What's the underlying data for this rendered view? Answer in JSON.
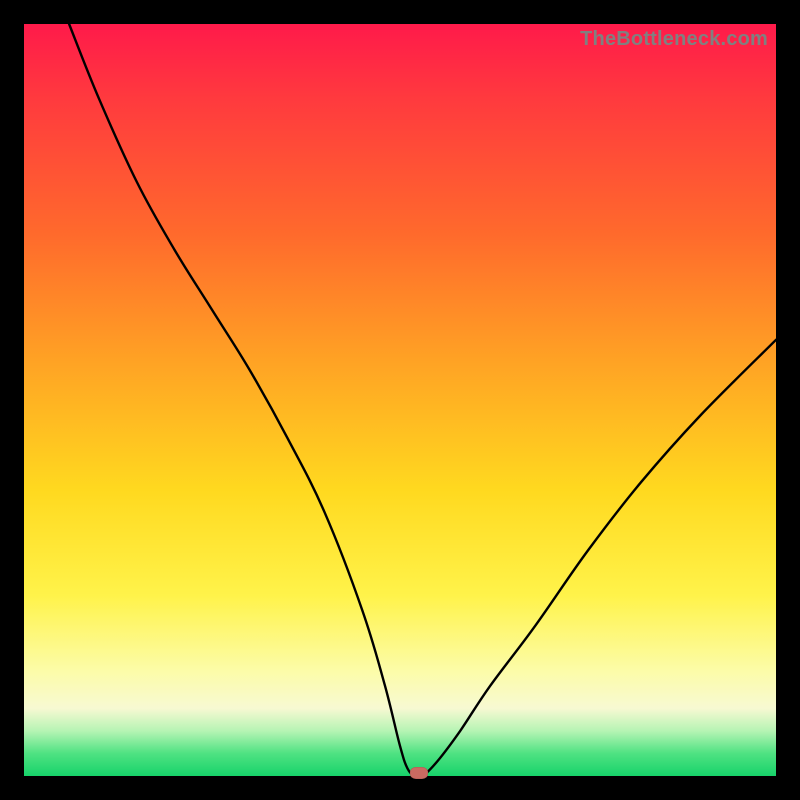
{
  "watermark": "TheBottleneck.com",
  "chart_data": {
    "type": "line",
    "title": "",
    "xlabel": "",
    "ylabel": "",
    "xlim": [
      0,
      100
    ],
    "ylim": [
      0,
      100
    ],
    "grid": false,
    "legend": false,
    "marker": {
      "x": 52.5,
      "y": 0
    },
    "series": [
      {
        "name": "curve",
        "x": [
          6,
          10,
          15,
          20,
          25,
          30,
          35,
          40,
          45,
          48,
          50,
          51,
          52,
          53,
          55,
          58,
          62,
          68,
          75,
          82,
          90,
          100
        ],
        "y": [
          100,
          90,
          79,
          70,
          62,
          54,
          45,
          35,
          22,
          12,
          4,
          1,
          0,
          0,
          2,
          6,
          12,
          20,
          30,
          39,
          48,
          58
        ]
      }
    ],
    "background_gradient": {
      "direction": "vertical",
      "stops": [
        {
          "pos": 0.0,
          "color": "#ff1a4a"
        },
        {
          "pos": 0.45,
          "color": "#ffa324"
        },
        {
          "pos": 0.76,
          "color": "#fff34a"
        },
        {
          "pos": 0.94,
          "color": "#b6f4b4"
        },
        {
          "pos": 1.0,
          "color": "#17d36a"
        }
      ]
    }
  }
}
